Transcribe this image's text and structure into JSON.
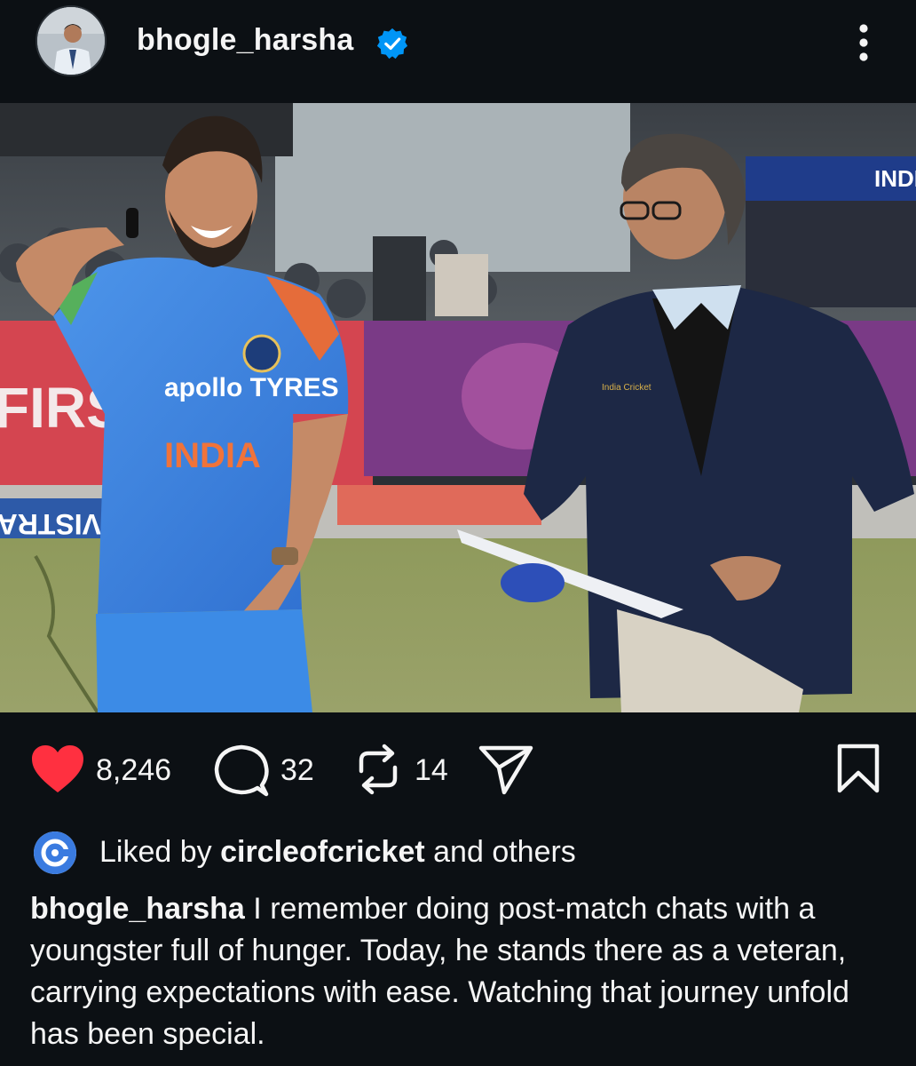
{
  "post": {
    "username": "bhogle_harsha",
    "verified": true,
    "likes": "8,246",
    "comments": "32",
    "reposts": "14",
    "liked_by_prefix": "Liked by",
    "liked_by_user": "circleofcricket",
    "liked_by_suffix": "and others",
    "caption_user": "bhogle_harsha",
    "caption_text": "I remember doing post-match chats with a youngster full of hunger. Today, he stands there as a veteran, carrying expectations with ease. Watching that journey unfold has been special."
  },
  "photo": {
    "jersey_sponsor": "apollo TYRES",
    "jersey_team": "INDIA",
    "board_text_left": "FIRS",
    "board_text_strip": "VISTRA",
    "board_text_topright": "INDI",
    "blazer_text": "India Cricket"
  },
  "colors": {
    "background": "#0c1014",
    "like_red": "#ff3040",
    "verified_blue": "#0095f6",
    "jersey_blue": "#3f86e0"
  },
  "icons": {
    "like": "heart-filled-icon",
    "comment": "speech-bubble-icon",
    "repost": "repost-arrows-icon",
    "share": "paper-plane-icon",
    "save": "bookmark-icon",
    "menu": "kebab-menu-icon",
    "verified": "verified-badge-icon"
  }
}
